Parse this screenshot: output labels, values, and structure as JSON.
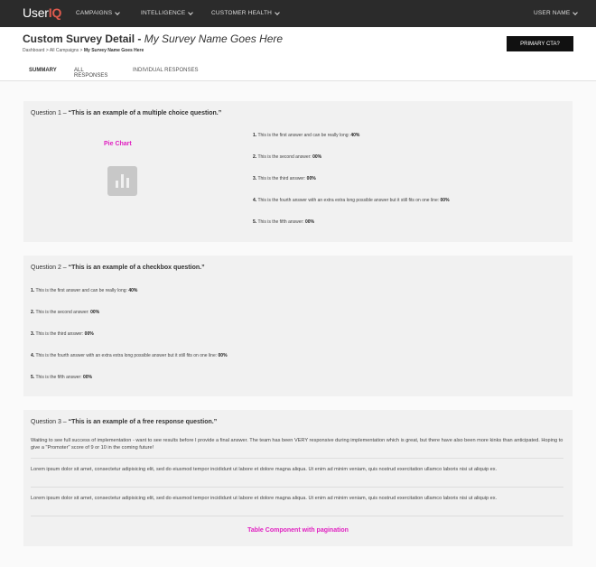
{
  "nav": {
    "logo_main": "User",
    "logo_accent": "IQ",
    "items": [
      "CAMPAIGNS",
      "INTELLIGENCE",
      "CUSTOMER HEALTH"
    ],
    "user": "USER NAME"
  },
  "header": {
    "title": "Custom Survey Detail - ",
    "subtitle": "My Survey Name Goes Here",
    "breadcrumb": {
      "part1": "Dashboard",
      "sep": " > ",
      "part2": "All Campaigns",
      "current": "My Survey Name Goes Here"
    },
    "cta": "PRIMARY CTA?"
  },
  "tabs": [
    "SUMMARY",
    "ALL RESPONSES",
    "INDIVIDUAL RESPONSES"
  ],
  "q1": {
    "prefix": "Question 1 – ",
    "text": "“This is an example of a multiple choice question.”",
    "pie_label": "Pie Chart",
    "answers": [
      {
        "num": "1.",
        "text": " This is the first answer and can be really long: ",
        "pct": "40%"
      },
      {
        "num": "2.",
        "text": " This is the second answer: ",
        "pct": "00%"
      },
      {
        "num": "3.",
        "text": " This is the third answer: ",
        "pct": "00%"
      },
      {
        "num": "4.",
        "text": " This is the fourth answer with an extra extra long possible answer but it still fits on one line: ",
        "pct": "00%"
      },
      {
        "num": "5.",
        "text": " This is the fifth answer: ",
        "pct": "00%"
      }
    ]
  },
  "q2": {
    "prefix": "Question 2 – ",
    "text": "“This is an example of a checkbox question.”",
    "answers": [
      {
        "num": "1.",
        "text": " This is the first answer and can be really long: ",
        "pct": "40%"
      },
      {
        "num": "2.",
        "text": " This is the second answer: ",
        "pct": "00%"
      },
      {
        "num": "3.",
        "text": " This is the third answer: ",
        "pct": "00%"
      },
      {
        "num": "4.",
        "text": " This is the fourth answer with an extra extra long possible answer but it still fits on one line: ",
        "pct": "00%"
      },
      {
        "num": "5.",
        "text": " This is the fifth answer: ",
        "pct": "00%"
      }
    ]
  },
  "q3": {
    "prefix": "Question 3 – ",
    "text": "“This is an example of a free response question.”",
    "responses": [
      "Waiting to see full success of implementation - want to see results before I provide a final answer. The team has been VERY responsive during implementation which is great, but there have also been more kinks than anticipated. Hoping to give a \"Promoter\" score of 9 or 10 in the coming future!",
      "Lorem ipsum dolor sit amet, consectetur adipisicing elit, sed do eiusmod tempor incididunt ut labore et dolore magna aliqua. Ut enim ad minim veniam, quis nostrud exercitation ullamco laboris nisi ut aliquip ex.",
      "Lorem ipsum dolor sit amet, consectetur adipisicing elit, sed do eiusmod tempor incididunt ut labore et dolore magna aliqua. Ut enim ad minim veniam, quis nostrud exercitation ullamco laboris nisi ut aliquip ex."
    ],
    "table_label": "Table Component with pagination"
  }
}
